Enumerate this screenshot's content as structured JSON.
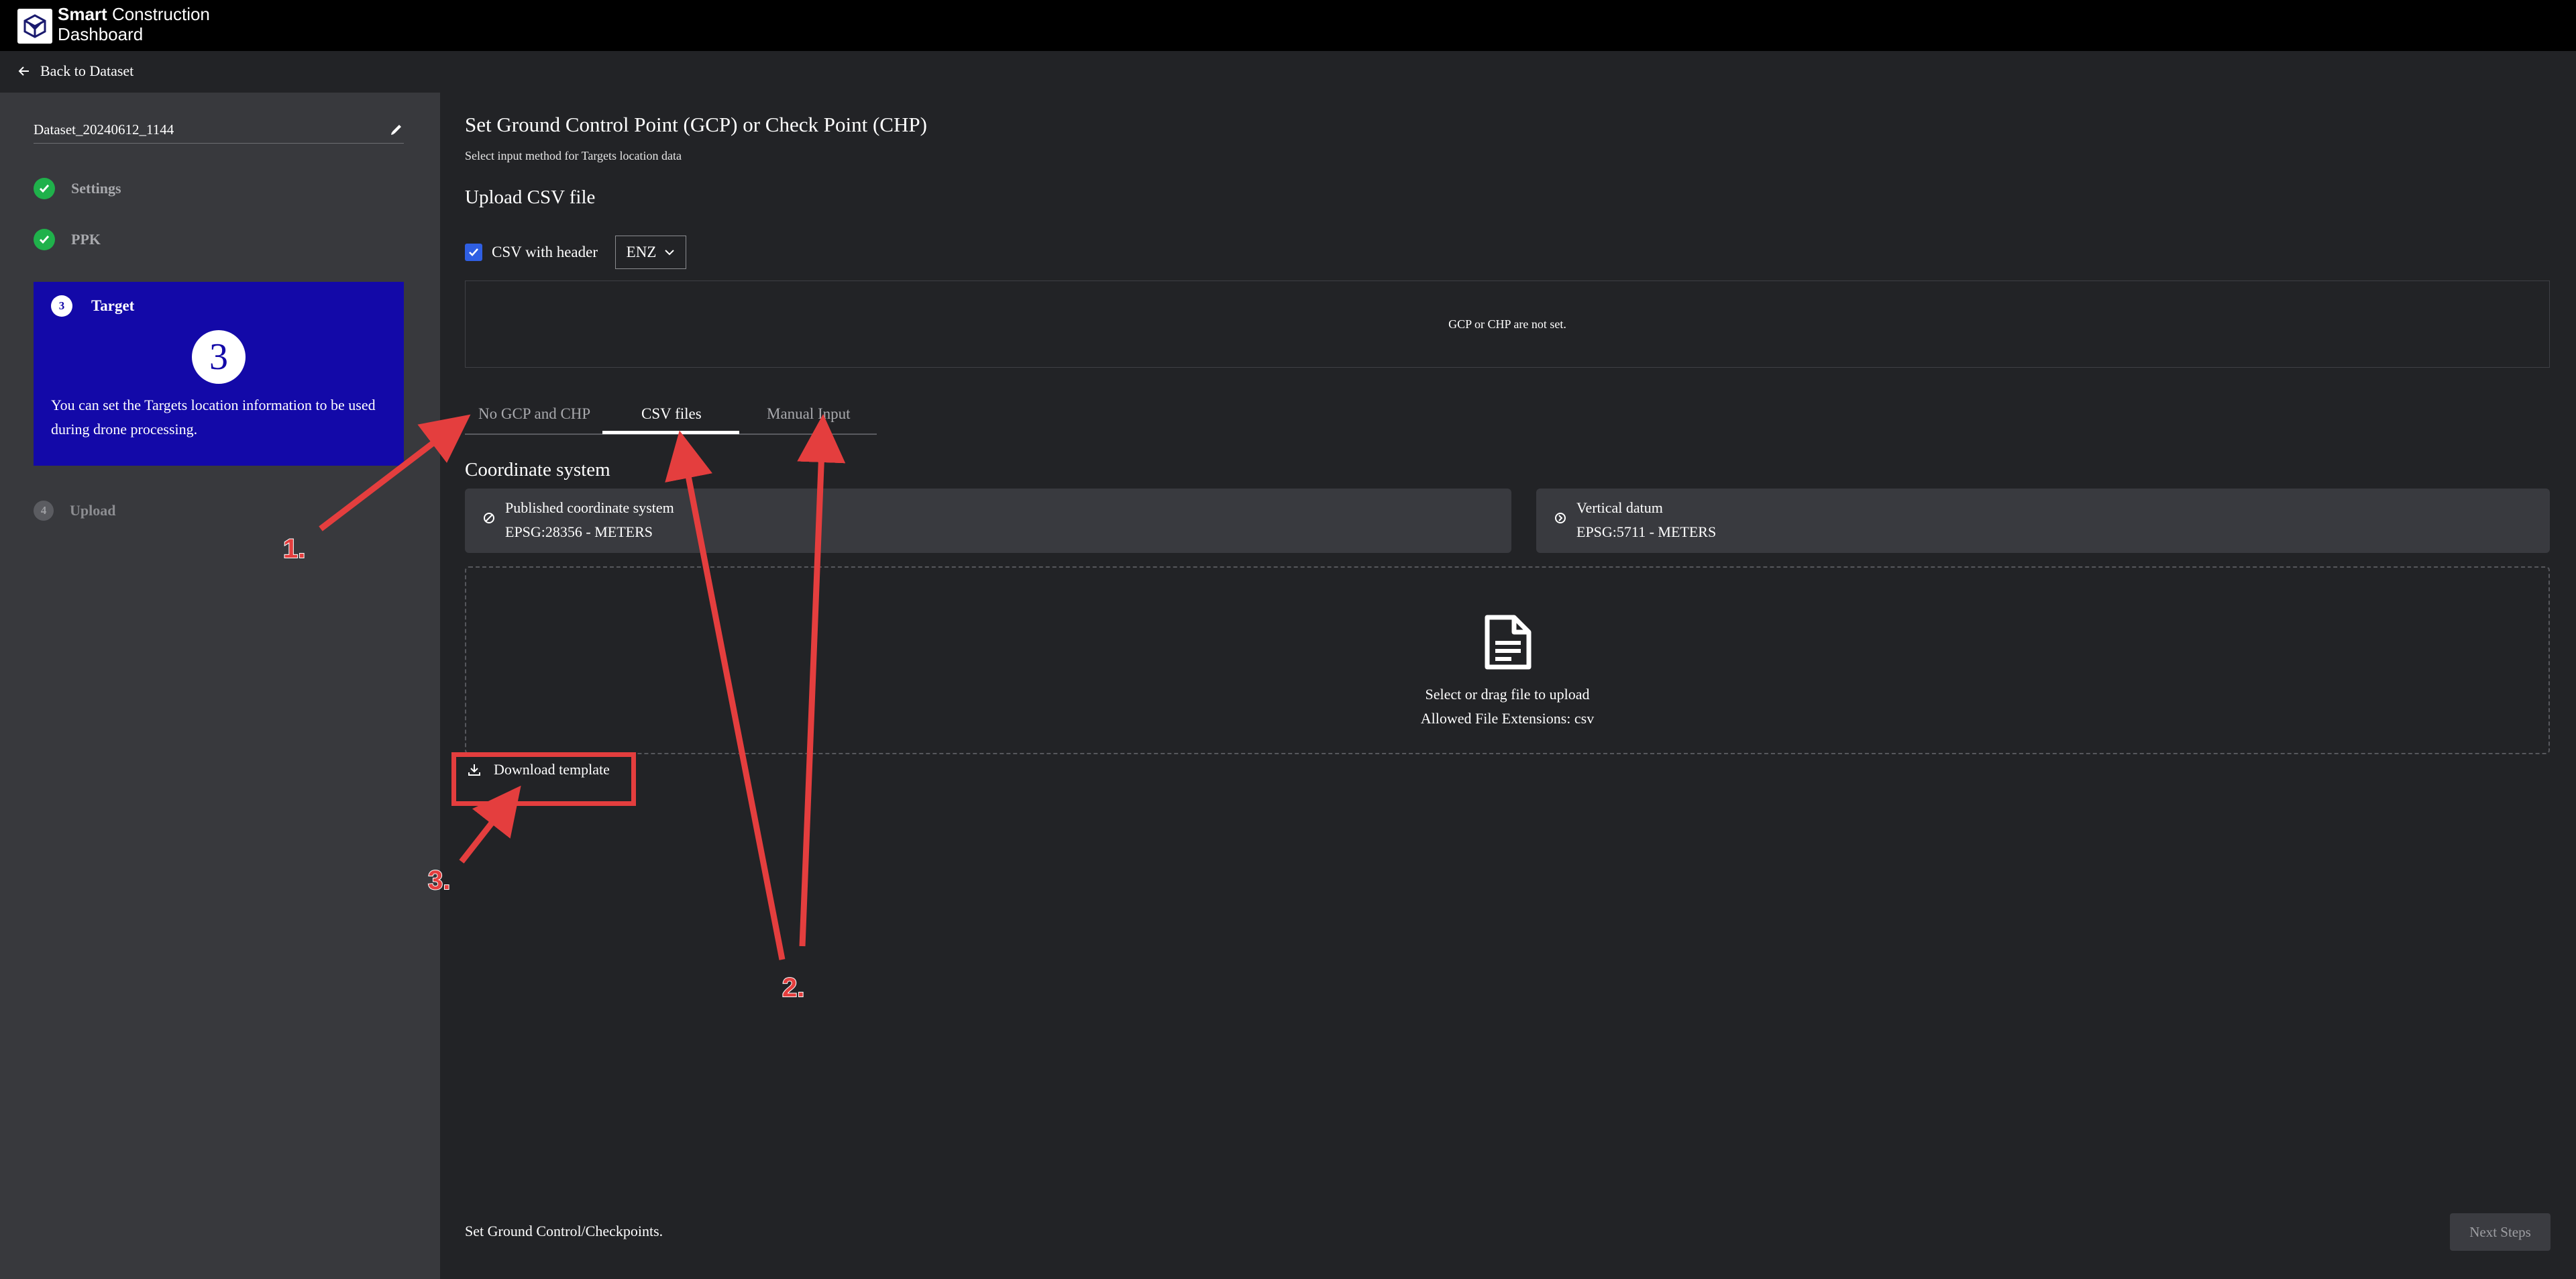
{
  "app": {
    "brand_bold": "Smart",
    "brand_rest": "Construction",
    "brand_line2": "Dashboard"
  },
  "nav": {
    "back_label": "Back to Dataset"
  },
  "sidebar": {
    "dataset_name": "Dataset_20240612_1144",
    "steps": [
      {
        "label": "Settings",
        "status": "done"
      },
      {
        "label": "PPK",
        "status": "done"
      },
      {
        "number": "3",
        "label": "Target",
        "status": "active",
        "big_number": "3",
        "description": "You can set the Targets location information to be used during drone processing."
      },
      {
        "number": "4",
        "label": "Upload",
        "status": "pending"
      }
    ]
  },
  "main": {
    "title": "Set Ground Control Point (GCP) or Check Point (CHP)",
    "subtitle": "Select input method for Targets location data",
    "upload_section": "Upload CSV file",
    "csv_header_label": "CSV with header",
    "csv_header_checked": true,
    "csv_format": "ENZ",
    "gcp_status": "GCP or CHP are not set.",
    "tabs": [
      {
        "label": "No GCP and CHP",
        "active": false
      },
      {
        "label": "CSV files",
        "active": true
      },
      {
        "label": "Manual Input",
        "active": false
      }
    ],
    "coord_section": "Coordinate system",
    "published_coordinate": {
      "label": "Published coordinate system",
      "value": "EPSG:28356 - METERS"
    },
    "vertical_datum": {
      "label": "Vertical datum",
      "value": "EPSG:5711 - METERS"
    },
    "dropzone": {
      "line1": "Select or drag file to upload",
      "line2": "Allowed File Extensions: csv"
    },
    "download_template": "Download template"
  },
  "footer": {
    "text": "Set Ground Control/Checkpoints.",
    "next_button": "Next Steps"
  },
  "annotations": {
    "labels": [
      "1.",
      "2.",
      "3."
    ],
    "color": "#e43e3e"
  },
  "colors": {
    "accent": "#1309a8",
    "success": "#1fb14b",
    "checkbox": "#2f5fe3",
    "sidebar_bg": "#38393d",
    "page_bg": "#222326"
  }
}
